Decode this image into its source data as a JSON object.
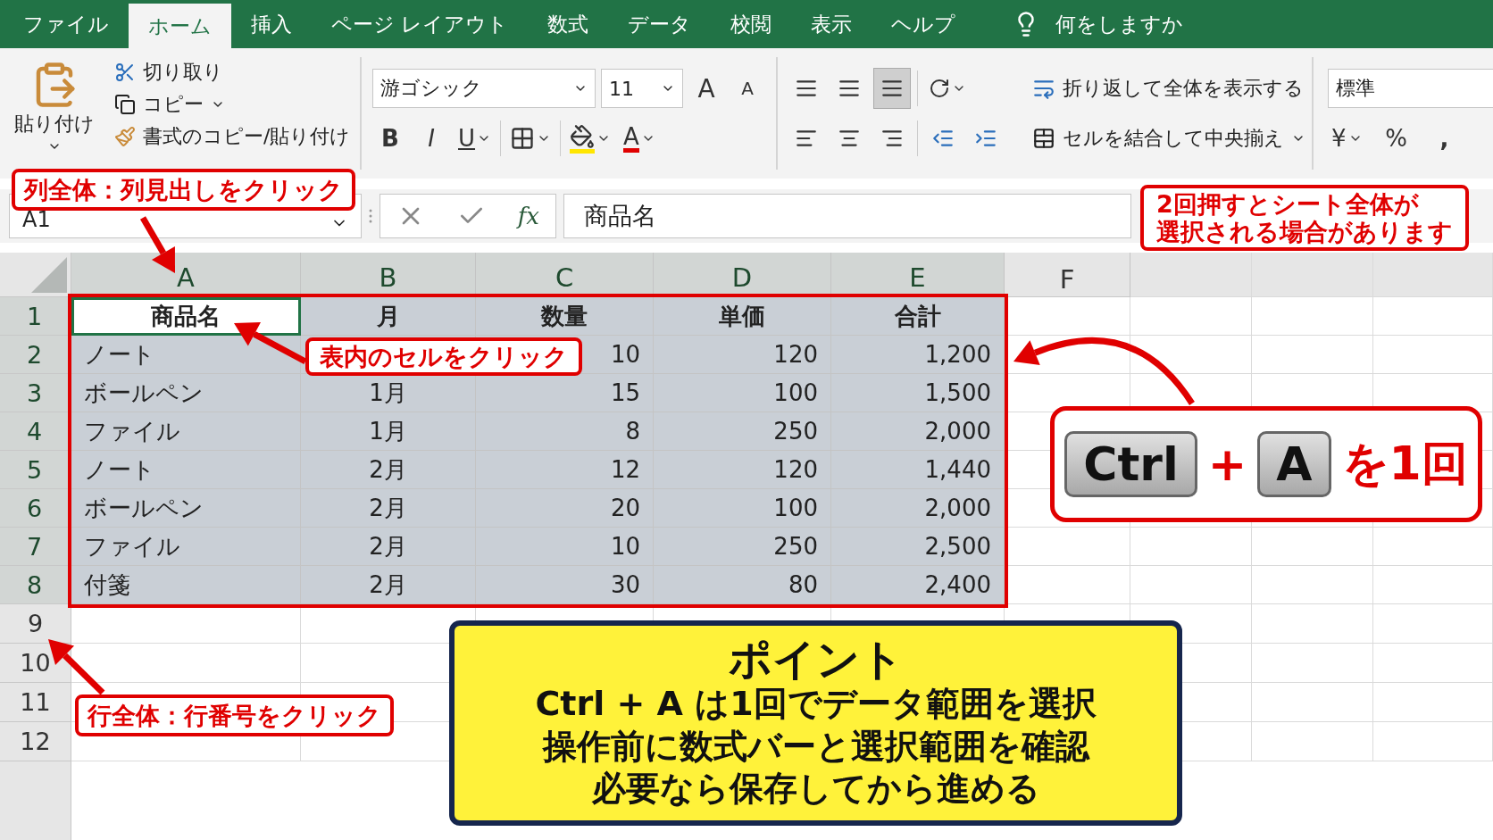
{
  "tabs": [
    {
      "label": "ファイル",
      "selected": false
    },
    {
      "label": "ホーム",
      "selected": true
    },
    {
      "label": "挿入",
      "selected": false
    },
    {
      "label": "ページ レイアウト",
      "selected": false
    },
    {
      "label": "数式",
      "selected": false
    },
    {
      "label": "データ",
      "selected": false
    },
    {
      "label": "校閲",
      "selected": false
    },
    {
      "label": "表示",
      "selected": false
    },
    {
      "label": "ヘルプ",
      "selected": false
    }
  ],
  "tell_me": "何をしますか",
  "clipboard": {
    "paste": "貼り付け",
    "cut": "切り取り",
    "copy": "コピー",
    "format_painter": "書式のコピー/貼り付け"
  },
  "font": {
    "name": "游ゴシック",
    "size": "11",
    "grow": "A",
    "shrink": "A",
    "bold": "B",
    "italic": "I",
    "underline": "U",
    "font_color": "A"
  },
  "vertical_align": [
    {
      "selected": false
    },
    {
      "selected": false
    },
    {
      "selected": true
    }
  ],
  "wrap_text": "折り返して全体を表示する",
  "merge": "セルを結合して中央揃え",
  "number": {
    "format": "標準",
    "currency": "¥",
    "percent": "%",
    "comma": ","
  },
  "name_box": "A1",
  "fx": "fx",
  "formula": "商品名",
  "columns": [
    {
      "label": "A",
      "selected": true
    },
    {
      "label": "B",
      "selected": true
    },
    {
      "label": "C",
      "selected": true
    },
    {
      "label": "D",
      "selected": true
    },
    {
      "label": "E",
      "selected": true
    },
    {
      "label": "F",
      "selected": false
    }
  ],
  "rows": [
    {
      "header": "1",
      "selected": true,
      "cells": [
        {
          "text": "商品名",
          "active": true
        },
        {
          "text": "月",
          "active": false
        },
        {
          "text": "数量",
          "active": false
        },
        {
          "text": "単価",
          "active": false
        },
        {
          "text": "合計",
          "active": false
        }
      ]
    },
    {
      "header": "2",
      "selected": true,
      "cells": [
        {
          "text": "ノート",
          "active": false
        },
        {
          "text": null,
          "active": false
        },
        {
          "text": "10",
          "active": false
        },
        {
          "text": "120",
          "active": false
        },
        {
          "text": "1,200",
          "active": false
        }
      ]
    },
    {
      "header": "3",
      "selected": true,
      "cells": [
        {
          "text": "ボールペン",
          "active": false
        },
        {
          "text": "1月",
          "active": false
        },
        {
          "text": "15",
          "active": false
        },
        {
          "text": "100",
          "active": false
        },
        {
          "text": "1,500",
          "active": false
        }
      ]
    },
    {
      "header": "4",
      "selected": true,
      "cells": [
        {
          "text": "ファイル",
          "active": false
        },
        {
          "text": "1月",
          "active": false
        },
        {
          "text": "8",
          "active": false
        },
        {
          "text": "250",
          "active": false
        },
        {
          "text": "2,000",
          "active": false
        }
      ]
    },
    {
      "header": "5",
      "selected": true,
      "cells": [
        {
          "text": "ノート",
          "active": false
        },
        {
          "text": "2月",
          "active": false
        },
        {
          "text": "12",
          "active": false
        },
        {
          "text": "120",
          "active": false
        },
        {
          "text": "1,440",
          "active": false
        }
      ]
    },
    {
      "header": "6",
      "selected": true,
      "cells": [
        {
          "text": "ボールペン",
          "active": false
        },
        {
          "text": "2月",
          "active": false
        },
        {
          "text": "20",
          "active": false
        },
        {
          "text": "100",
          "active": false
        },
        {
          "text": "2,000",
          "active": false
        }
      ]
    },
    {
      "header": "7",
      "selected": true,
      "cells": [
        {
          "text": "ファイル",
          "active": false
        },
        {
          "text": "2月",
          "active": false
        },
        {
          "text": "10",
          "active": false
        },
        {
          "text": "250",
          "active": false
        },
        {
          "text": "2,500",
          "active": false
        }
      ]
    },
    {
      "header": "8",
      "selected": true,
      "cells": [
        {
          "text": "付箋",
          "active": false
        },
        {
          "text": "2月",
          "active": false
        },
        {
          "text": "30",
          "active": false
        },
        {
          "text": "80",
          "active": false
        },
        {
          "text": "2,400",
          "active": false
        }
      ]
    },
    {
      "header": "9",
      "selected": false,
      "cells": []
    },
    {
      "header": "10",
      "selected": false,
      "cells": []
    },
    {
      "header": "11",
      "selected": false,
      "cells": []
    },
    {
      "header": "12",
      "selected": false,
      "cells": []
    }
  ],
  "callouts": {
    "column": "列全体：列見出しをクリック",
    "cell": "表内のセルをクリック",
    "row": "行全体：行番号をクリック",
    "twice": [
      "2回押すとシート全体が",
      "選択される場合があります"
    ]
  },
  "shortcut": {
    "keys": [
      "Ctrl",
      "A"
    ],
    "plus": "+",
    "count": "を1回"
  },
  "point": {
    "title": "ポイント",
    "lines": [
      "Ctrl + A は1回でデータ範囲を選択",
      "操作前に数式バーと選択範囲を確認",
      "必要なら保存してから進める"
    ]
  }
}
